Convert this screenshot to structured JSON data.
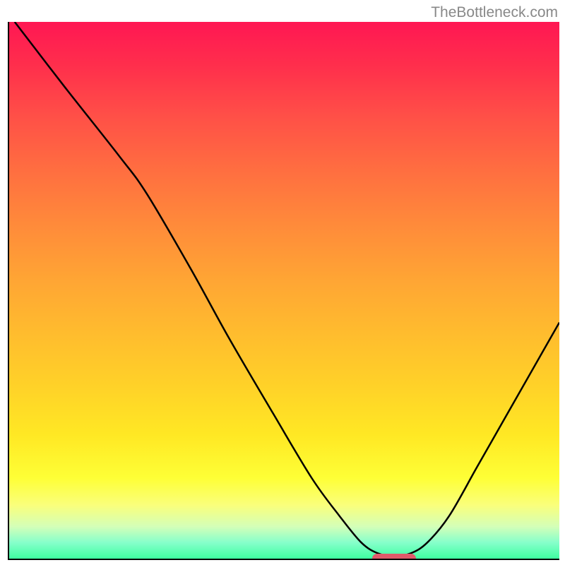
{
  "watermark": "TheBottleneck.com",
  "chart_data": {
    "type": "line",
    "title": "",
    "xlabel": "",
    "ylabel": "",
    "xlim": [
      0,
      100
    ],
    "ylim": [
      0,
      100
    ],
    "curve_points": [
      {
        "x": 1,
        "y": 100
      },
      {
        "x": 10,
        "y": 88
      },
      {
        "x": 20,
        "y": 75
      },
      {
        "x": 25,
        "y": 68
      },
      {
        "x": 33,
        "y": 54
      },
      {
        "x": 40,
        "y": 41
      },
      {
        "x": 48,
        "y": 27
      },
      {
        "x": 55,
        "y": 15
      },
      {
        "x": 60,
        "y": 8
      },
      {
        "x": 64,
        "y": 3
      },
      {
        "x": 67,
        "y": 1
      },
      {
        "x": 70,
        "y": 0.5
      },
      {
        "x": 73,
        "y": 1
      },
      {
        "x": 76,
        "y": 3
      },
      {
        "x": 80,
        "y": 8
      },
      {
        "x": 85,
        "y": 17
      },
      {
        "x": 90,
        "y": 26
      },
      {
        "x": 95,
        "y": 35
      },
      {
        "x": 100,
        "y": 44
      }
    ],
    "marker": {
      "x_start": 66,
      "x_end": 74,
      "y": 0
    },
    "gradient": {
      "top_color": "#ff1753",
      "bottom_color": "#3effa0"
    }
  }
}
